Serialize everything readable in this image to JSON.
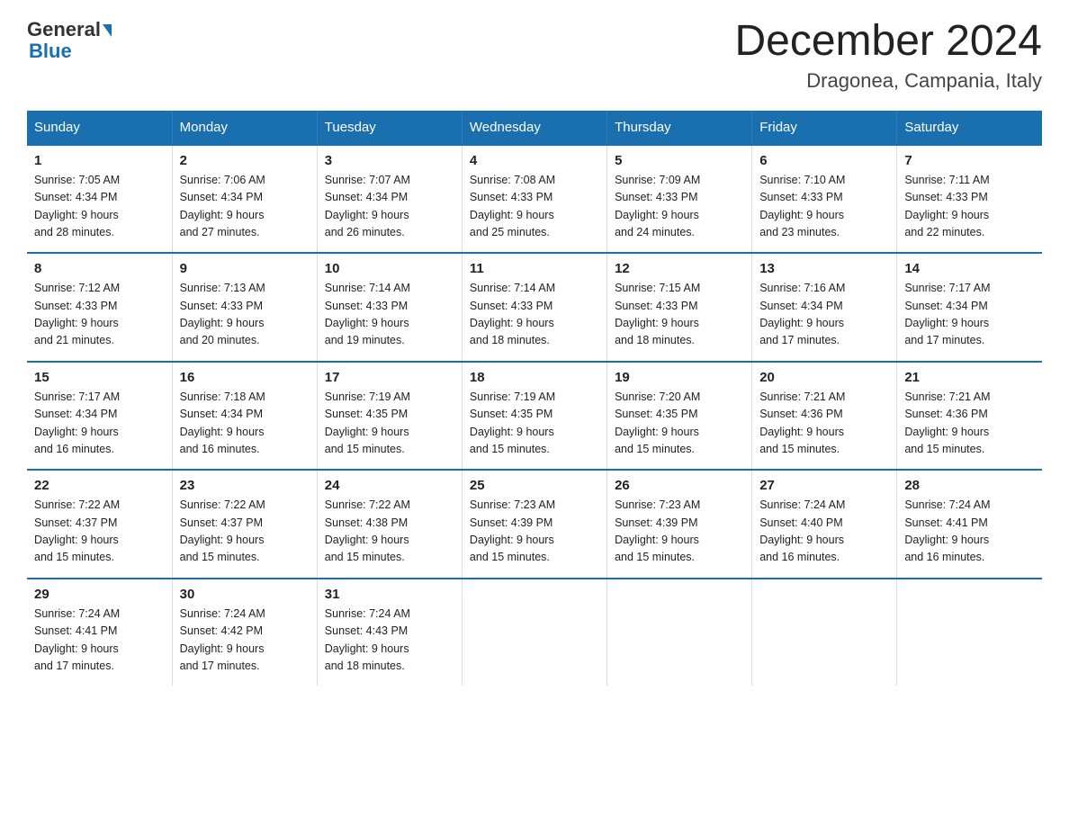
{
  "header": {
    "logo_general": "General",
    "logo_blue": "Blue",
    "month_title": "December 2024",
    "location": "Dragonea, Campania, Italy"
  },
  "days_of_week": [
    "Sunday",
    "Monday",
    "Tuesday",
    "Wednesday",
    "Thursday",
    "Friday",
    "Saturday"
  ],
  "weeks": [
    [
      {
        "day": "1",
        "info": "Sunrise: 7:05 AM\nSunset: 4:34 PM\nDaylight: 9 hours\nand 28 minutes."
      },
      {
        "day": "2",
        "info": "Sunrise: 7:06 AM\nSunset: 4:34 PM\nDaylight: 9 hours\nand 27 minutes."
      },
      {
        "day": "3",
        "info": "Sunrise: 7:07 AM\nSunset: 4:34 PM\nDaylight: 9 hours\nand 26 minutes."
      },
      {
        "day": "4",
        "info": "Sunrise: 7:08 AM\nSunset: 4:33 PM\nDaylight: 9 hours\nand 25 minutes."
      },
      {
        "day": "5",
        "info": "Sunrise: 7:09 AM\nSunset: 4:33 PM\nDaylight: 9 hours\nand 24 minutes."
      },
      {
        "day": "6",
        "info": "Sunrise: 7:10 AM\nSunset: 4:33 PM\nDaylight: 9 hours\nand 23 minutes."
      },
      {
        "day": "7",
        "info": "Sunrise: 7:11 AM\nSunset: 4:33 PM\nDaylight: 9 hours\nand 22 minutes."
      }
    ],
    [
      {
        "day": "8",
        "info": "Sunrise: 7:12 AM\nSunset: 4:33 PM\nDaylight: 9 hours\nand 21 minutes."
      },
      {
        "day": "9",
        "info": "Sunrise: 7:13 AM\nSunset: 4:33 PM\nDaylight: 9 hours\nand 20 minutes."
      },
      {
        "day": "10",
        "info": "Sunrise: 7:14 AM\nSunset: 4:33 PM\nDaylight: 9 hours\nand 19 minutes."
      },
      {
        "day": "11",
        "info": "Sunrise: 7:14 AM\nSunset: 4:33 PM\nDaylight: 9 hours\nand 18 minutes."
      },
      {
        "day": "12",
        "info": "Sunrise: 7:15 AM\nSunset: 4:33 PM\nDaylight: 9 hours\nand 18 minutes."
      },
      {
        "day": "13",
        "info": "Sunrise: 7:16 AM\nSunset: 4:34 PM\nDaylight: 9 hours\nand 17 minutes."
      },
      {
        "day": "14",
        "info": "Sunrise: 7:17 AM\nSunset: 4:34 PM\nDaylight: 9 hours\nand 17 minutes."
      }
    ],
    [
      {
        "day": "15",
        "info": "Sunrise: 7:17 AM\nSunset: 4:34 PM\nDaylight: 9 hours\nand 16 minutes."
      },
      {
        "day": "16",
        "info": "Sunrise: 7:18 AM\nSunset: 4:34 PM\nDaylight: 9 hours\nand 16 minutes."
      },
      {
        "day": "17",
        "info": "Sunrise: 7:19 AM\nSunset: 4:35 PM\nDaylight: 9 hours\nand 15 minutes."
      },
      {
        "day": "18",
        "info": "Sunrise: 7:19 AM\nSunset: 4:35 PM\nDaylight: 9 hours\nand 15 minutes."
      },
      {
        "day": "19",
        "info": "Sunrise: 7:20 AM\nSunset: 4:35 PM\nDaylight: 9 hours\nand 15 minutes."
      },
      {
        "day": "20",
        "info": "Sunrise: 7:21 AM\nSunset: 4:36 PM\nDaylight: 9 hours\nand 15 minutes."
      },
      {
        "day": "21",
        "info": "Sunrise: 7:21 AM\nSunset: 4:36 PM\nDaylight: 9 hours\nand 15 minutes."
      }
    ],
    [
      {
        "day": "22",
        "info": "Sunrise: 7:22 AM\nSunset: 4:37 PM\nDaylight: 9 hours\nand 15 minutes."
      },
      {
        "day": "23",
        "info": "Sunrise: 7:22 AM\nSunset: 4:37 PM\nDaylight: 9 hours\nand 15 minutes."
      },
      {
        "day": "24",
        "info": "Sunrise: 7:22 AM\nSunset: 4:38 PM\nDaylight: 9 hours\nand 15 minutes."
      },
      {
        "day": "25",
        "info": "Sunrise: 7:23 AM\nSunset: 4:39 PM\nDaylight: 9 hours\nand 15 minutes."
      },
      {
        "day": "26",
        "info": "Sunrise: 7:23 AM\nSunset: 4:39 PM\nDaylight: 9 hours\nand 15 minutes."
      },
      {
        "day": "27",
        "info": "Sunrise: 7:24 AM\nSunset: 4:40 PM\nDaylight: 9 hours\nand 16 minutes."
      },
      {
        "day": "28",
        "info": "Sunrise: 7:24 AM\nSunset: 4:41 PM\nDaylight: 9 hours\nand 16 minutes."
      }
    ],
    [
      {
        "day": "29",
        "info": "Sunrise: 7:24 AM\nSunset: 4:41 PM\nDaylight: 9 hours\nand 17 minutes."
      },
      {
        "day": "30",
        "info": "Sunrise: 7:24 AM\nSunset: 4:42 PM\nDaylight: 9 hours\nand 17 minutes."
      },
      {
        "day": "31",
        "info": "Sunrise: 7:24 AM\nSunset: 4:43 PM\nDaylight: 9 hours\nand 18 minutes."
      },
      {
        "day": "",
        "info": ""
      },
      {
        "day": "",
        "info": ""
      },
      {
        "day": "",
        "info": ""
      },
      {
        "day": "",
        "info": ""
      }
    ]
  ]
}
